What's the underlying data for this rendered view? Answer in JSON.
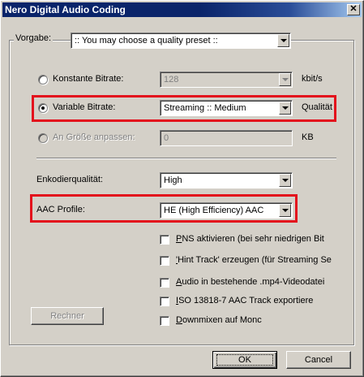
{
  "window": {
    "title": "Nero Digital Audio Coding",
    "close_glyph": "✕"
  },
  "preset": {
    "label": "Vorgabe:",
    "value": ":: You may choose a quality preset ::"
  },
  "mode": {
    "constant": {
      "label": "Konstante Bitrate:",
      "value": "128",
      "unit": "kbit/s",
      "checked": false
    },
    "variable": {
      "label": "Variable Bitrate:",
      "value": "Streaming :: Medium",
      "unit": "Qualität",
      "checked": true
    },
    "size": {
      "label": "An Größe anpassen:",
      "value": "0",
      "unit": "KB",
      "enabled": false
    }
  },
  "quality": {
    "label": "Enkodierqualität:",
    "value": "High"
  },
  "profile": {
    "label": "AAC Profile:",
    "value": "HE (High Efficiency) AAC"
  },
  "options": [
    {
      "hotkey": "P",
      "rest": "NS aktivieren (bei sehr niedrigen Bit",
      "checked": false
    },
    {
      "hotkey": "'",
      "rest": "Hint Track' erzeugen (für Streaming Se",
      "checked": false
    },
    {
      "hotkey": "A",
      "rest": "udio in bestehende .mp4-Videodatei",
      "checked": false
    },
    {
      "hotkey": "I",
      "rest": "SO 13818-7 AAC Track exportiere",
      "checked": false
    },
    {
      "hotkey": "D",
      "rest": "ownmixen auf Monc",
      "checked": false
    }
  ],
  "buttons": {
    "calculator": "Rechner",
    "ok": "OK",
    "cancel": "Cancel"
  },
  "highlight_color": "#e3101c"
}
